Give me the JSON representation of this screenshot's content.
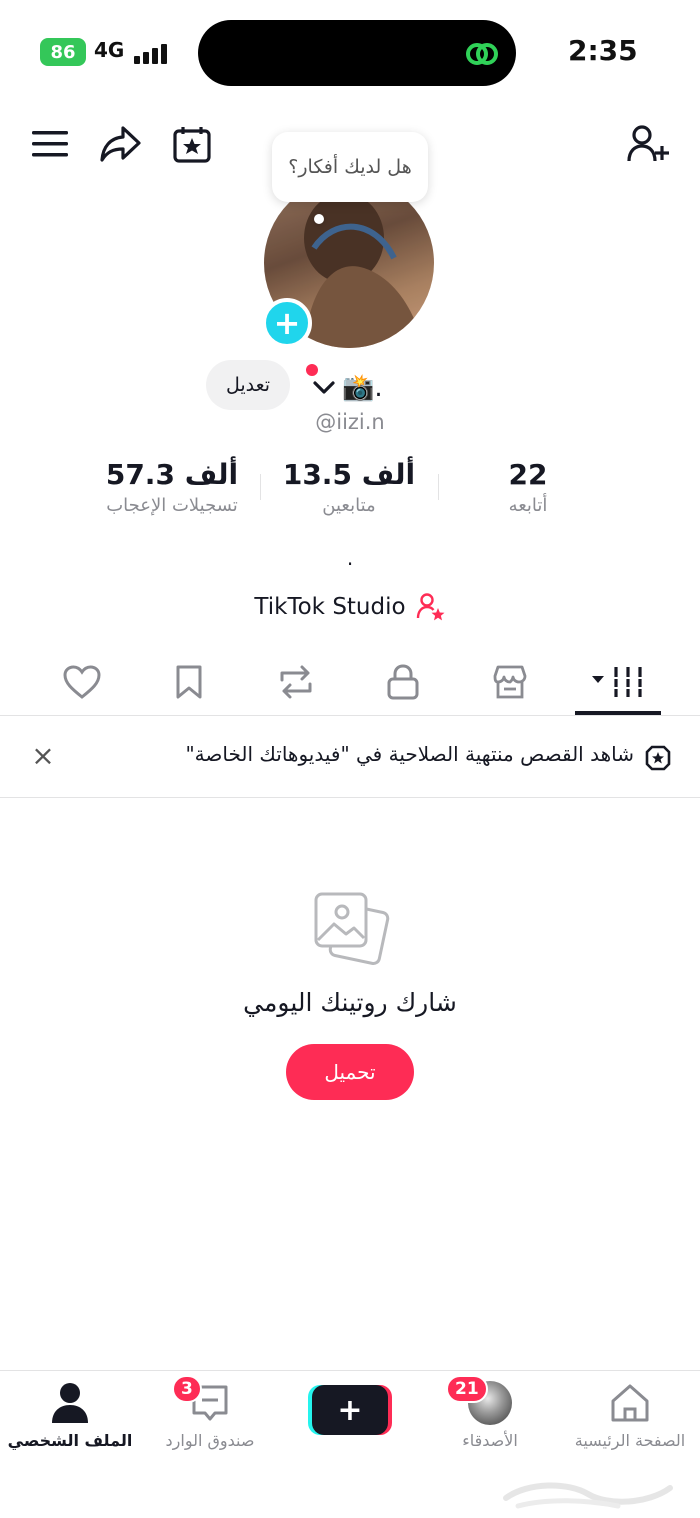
{
  "status_bar": {
    "battery": "86",
    "network": "4G",
    "time": "2:35"
  },
  "header": {
    "tooltip": "هل لديك أفكار؟"
  },
  "profile": {
    "edit_label": "تعديل",
    "username_symbol": "📸.",
    "handle": "@iizi.n",
    "stats": [
      {
        "value": "57.3 ألف",
        "label": "تسجيلات الإعجاب"
      },
      {
        "value": "13.5 ألف",
        "label": "متابعين"
      },
      {
        "value": "22",
        "label": "أتابعه"
      }
    ],
    "bio": ".",
    "studio_label": "TikTok Studio"
  },
  "notice": {
    "text": "شاهد القصص منتهية الصلاحية في \"فيديوهاتك الخاصة\""
  },
  "empty_state": {
    "title": "شارك روتينك اليومي",
    "button": "تحميل"
  },
  "bottom_nav": {
    "profile": "الملف الشخصي",
    "inbox": "صندوق الوارد",
    "inbox_badge": "3",
    "friends": "الأصدقاء",
    "friends_badge": "21",
    "home": "الصفحة الرئيسية"
  },
  "colors": {
    "accent": "#fe2c55",
    "cyan": "#20d5ec",
    "battery": "#34c759"
  }
}
